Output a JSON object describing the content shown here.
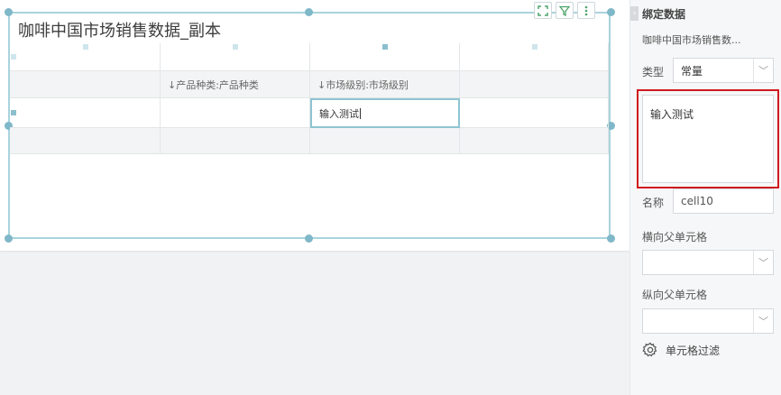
{
  "widget": {
    "title": "咖啡中国市场销售数据_副本",
    "toolbar": {
      "expand_icon": "expand-icon",
      "filter_icon": "filter-icon",
      "more_icon": "more-vertical-icon"
    }
  },
  "grid": {
    "rows": [
      {
        "shaded": false,
        "cells": [
          "",
          "",
          "",
          ""
        ]
      },
      {
        "shaded": true,
        "cells": [
          "",
          "↓产品种类:产品种类",
          "↓市场级别:市场级别",
          ""
        ]
      },
      {
        "shaded": false,
        "cells": [
          "",
          "",
          "输入测试",
          ""
        ]
      },
      {
        "shaded": true,
        "cells": [
          "",
          "",
          "",
          ""
        ]
      }
    ]
  },
  "panel": {
    "title": "绑定数据",
    "dataset_name": "咖啡中国市场销售数...",
    "type_label": "类型",
    "type_value": "常量",
    "value_text": "输入测试",
    "name_label": "名称",
    "name_value": "cell10",
    "h_parent_label": "横向父单元格",
    "h_parent_value": "",
    "v_parent_label": "纵向父单元格",
    "v_parent_value": "",
    "filter_label": "单元格过滤",
    "accent_color": "#d0191f"
  }
}
